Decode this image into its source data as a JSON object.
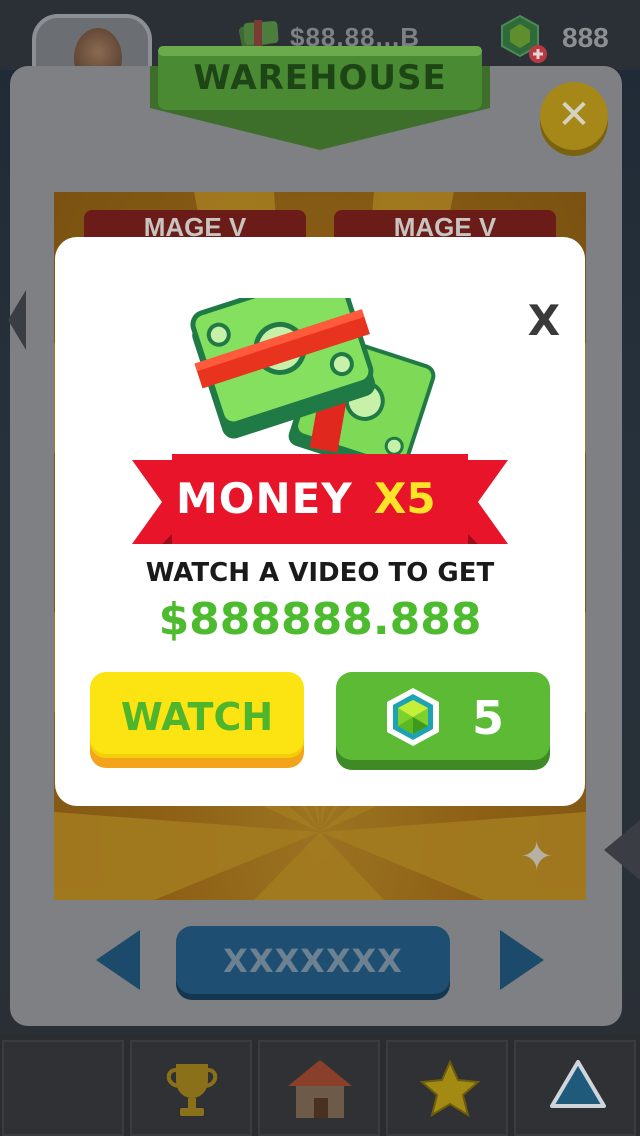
{
  "hud": {
    "cash_amount": "$88,88...B",
    "gem_amount": "888"
  },
  "warehouse": {
    "title": "WAREHOUSE",
    "tabs": [
      "MAGE V",
      "MAGE V"
    ],
    "name_button": "XXXXXXX"
  },
  "dialog": {
    "banner_money": "MONEY",
    "banner_multiplier": "X5",
    "description": "WATCH A VIDEO TO GET",
    "reward_amount": "$888888.888",
    "close_label": "X",
    "watch_button": "WATCH",
    "gem_cost": "5"
  },
  "bottom_nav": {
    "items": [
      {
        "icon": "blank"
      },
      {
        "icon": "trophy-icon"
      },
      {
        "icon": "house-icon"
      },
      {
        "icon": "star-icon"
      },
      {
        "icon": "triangle-icon"
      }
    ]
  },
  "colors": {
    "accent_green": "#4dbb2e",
    "watch_yellow": "#fce312",
    "ribbon_red": "#e8142a",
    "multiplier_yellow": "#ffe428"
  }
}
